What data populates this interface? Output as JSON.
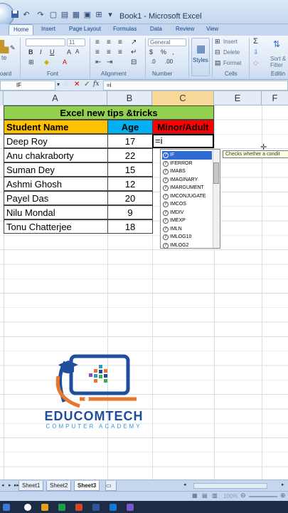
{
  "window": {
    "title": "Book1 - Microsoft Excel"
  },
  "tabs": [
    {
      "label": "Home",
      "active": true
    },
    {
      "label": "Insert"
    },
    {
      "label": "Page Layout"
    },
    {
      "label": "Formulas"
    },
    {
      "label": "Data"
    },
    {
      "label": "Review"
    },
    {
      "label": "View"
    }
  ],
  "ribbon": {
    "groups": [
      "oard",
      "Font",
      "Alignment",
      "Number",
      "Cells",
      "Editin"
    ],
    "font_size": "11",
    "number_format": "General",
    "styles_label": "Styles",
    "cells_insert": "Insert",
    "cells_delete": "Delete",
    "cells_format": "Format",
    "sort_filter_1": "Sort &",
    "sort_filter_2": "Filter"
  },
  "formula_bar": {
    "name_box": "IF",
    "content": "=i"
  },
  "columns": [
    "A",
    "B",
    "C",
    "E",
    "F"
  ],
  "sheet": {
    "title": "Excel new tips &tricks",
    "headers": {
      "name": "Student Name",
      "age": "Age",
      "status": "Minor/Adult"
    },
    "rows": [
      {
        "name": "Deep  Roy",
        "age": "17"
      },
      {
        "name": "Anu  chakraborty",
        "age": "22"
      },
      {
        "name": "Suman Dey",
        "age": "15"
      },
      {
        "name": "Ashmi Ghosh",
        "age": "12"
      },
      {
        "name": "Payel Das",
        "age": "20"
      },
      {
        "name": "Nilu Mondal",
        "age": "9"
      },
      {
        "name": "Tonu Chatterjee",
        "age": "18"
      }
    ],
    "active_cell_text": "=i"
  },
  "autocomplete": {
    "items": [
      "IF",
      "IFERROR",
      "IMABS",
      "IMAGINARY",
      "IMARGUMENT",
      "IMCONJUGATE",
      "IMCOS",
      "IMDIV",
      "IMEXP",
      "IMLN",
      "IMLOG10",
      "IMLOG2"
    ],
    "selected": "IF",
    "tooltip": "Checks whether a condit"
  },
  "logo": {
    "brand": "EDUCOMTECH",
    "tagline": "COMPUTER ACADEMY"
  },
  "sheet_tabs": [
    {
      "label": "Sheet1"
    },
    {
      "label": "Sheet2"
    },
    {
      "label": "Sheet3",
      "active": true
    }
  ],
  "status": {
    "zoom": "100%"
  },
  "colors": {
    "title_bg": "#92d050",
    "header_name_bg": "#ffc000",
    "header_age_bg": "#00b0f0",
    "header_status_bg": "#ff0000",
    "logo_blue": "#1f4e9e",
    "logo_orange": "#e8762c"
  }
}
